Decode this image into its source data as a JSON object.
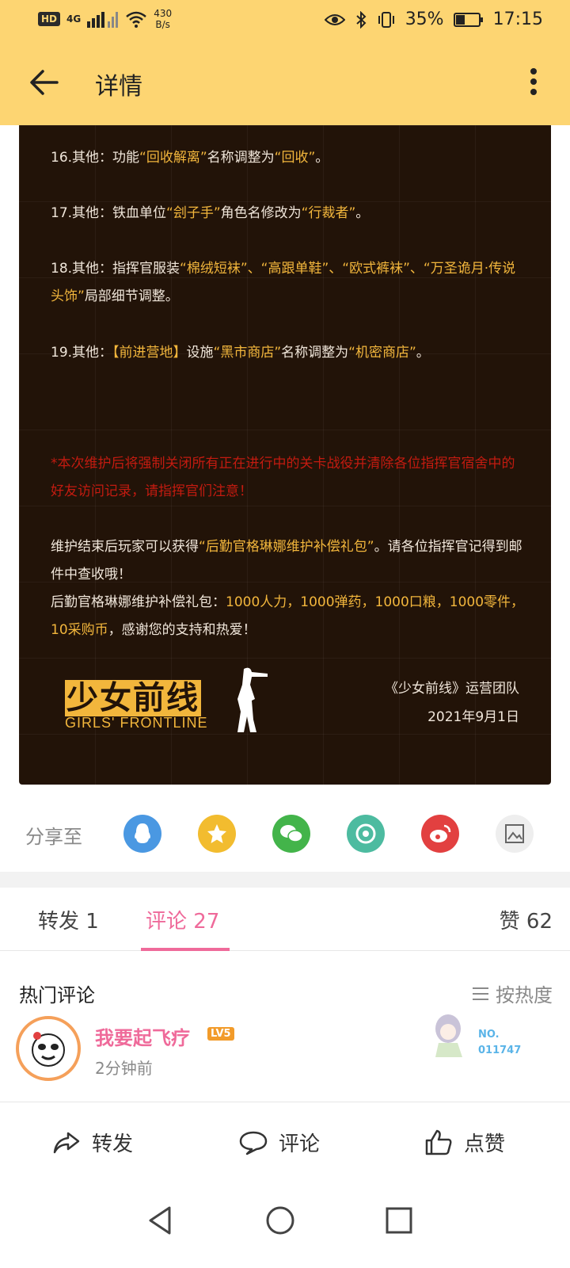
{
  "status_bar": {
    "hd_chip": "HD",
    "signal_label": "4G",
    "net_speed_value": "430",
    "net_speed_unit": "B/s",
    "battery_percent": "35%",
    "time": "17:15"
  },
  "app_bar": {
    "title": "详情"
  },
  "article": {
    "items": [
      {
        "prefix": "16.其他：功能",
        "q1": "“回收解离”",
        "mid": "名称调整为",
        "q2": "“回收”",
        "suffix": "。"
      },
      {
        "prefix": "17.其他：铁血单位",
        "q1": "“刽子手”",
        "mid": "角色名修改为",
        "q2": "“行裁者”",
        "suffix": "。"
      },
      {
        "prefix": "18.其他：指挥官服装",
        "q1": "“棉绒短袜”、“高跟单鞋”、“欧式裤袜”、“万圣诡月·传说头饰”",
        "suffix": "局部细节调整。"
      },
      {
        "prefix": "19.其他：",
        "q1": "【前进营地】",
        "mid": "设施",
        "q2": "“黑市商店”",
        "mid2": "名称调整为",
        "q3": "“机密商店”",
        "suffix": "。"
      }
    ],
    "warning": "*本次维护后将强制关闭所有正在进行中的关卡战役并清除各位指挥官宿舍中的好友访问记录，请指挥官们注意！",
    "reward_intro_1": "维护结束后玩家可以获得",
    "reward_pack_name": "“后勤官格琳娜维护补偿礼包”",
    "reward_intro_2": "。请各位指挥官记得到邮件中查收哦！",
    "reward_detail_prefix": "后勤官格琳娜维护补偿礼包：",
    "reward_detail": "1000人力，1000弹药，1000口粮，1000零件，10采购币",
    "reward_detail_suffix": "，感谢您的支持和热爱！",
    "logo_cn": "少女前线",
    "logo_en": "GIRLS' FRONTLINE",
    "signature": "《少女前线》运营团队",
    "date": "2021年9月1日"
  },
  "share": {
    "label": "分享至",
    "targets": [
      {
        "name": "qq",
        "color": "#4a98e2"
      },
      {
        "name": "qzone",
        "color": "#f2bc2f"
      },
      {
        "name": "wechat",
        "color": "#43b44a"
      },
      {
        "name": "moments",
        "color": "#4dbba0"
      },
      {
        "name": "weibo",
        "color": "#e24040"
      },
      {
        "name": "save-image",
        "color": "#eeeeee"
      }
    ]
  },
  "tabs": {
    "repost_label": "转发",
    "repost_count": "1",
    "comment_label": "评论",
    "comment_count": "27",
    "like_label": "赞",
    "like_count": "62"
  },
  "comments": {
    "header": "热门评论",
    "sort_label": "按热度",
    "items": [
      {
        "user": "我要起飞疗",
        "level": "LV5",
        "time": "2分钟前",
        "badge_label": "NO.",
        "badge_number": "011747"
      }
    ]
  },
  "actions": {
    "repost": "转发",
    "comment": "评论",
    "like": "点赞"
  }
}
